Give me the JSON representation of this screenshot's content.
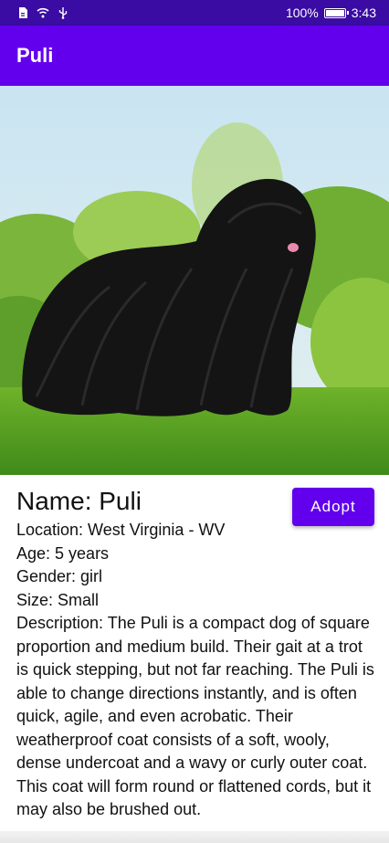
{
  "status_bar": {
    "battery_percent": "100%",
    "time": "3:43",
    "icons": [
      "document-icon",
      "wifi-icon",
      "usb-icon",
      "battery-icon"
    ]
  },
  "app_bar": {
    "title": "Puli"
  },
  "hero_image": {
    "alt": "black corded Puli dog standing on grass"
  },
  "pet": {
    "name": "Name: Puli",
    "location": "Location: West Virginia - WV",
    "age": "Age: 5 years",
    "gender": "Gender: girl",
    "size": "Size: Small",
    "description": "Description: The Puli is a compact dog of square proportion and medium build. Their gait at a trot is quick stepping, but not far reaching. The Puli is able to change directions instantly, and is often quick, agile, and even acrobatic. Their weatherproof coat consists of a soft, wooly, dense undercoat and a wavy or curly outer coat. This coat will form round or flattened cords, but it may also be brushed out."
  },
  "actions": {
    "adopt_label": "Adopt"
  },
  "colors": {
    "status_bar": "#3a0ca3",
    "primary": "#6200ee",
    "on_primary": "#ffffff"
  }
}
